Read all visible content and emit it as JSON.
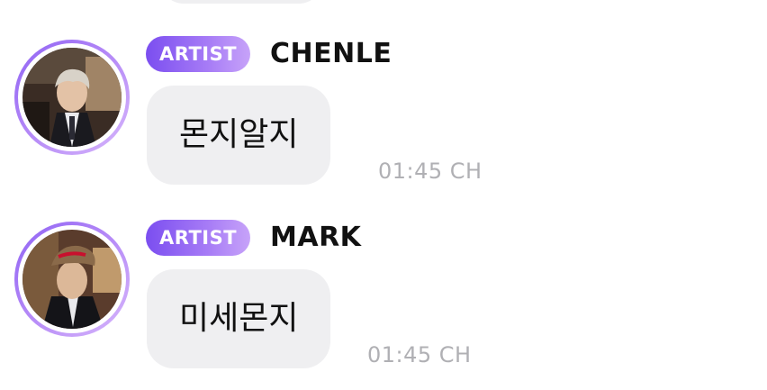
{
  "messages": [
    {
      "badge": "ARTIST",
      "author": "CHENLE",
      "text": "몬지알지",
      "time": "01:45 CH"
    },
    {
      "badge": "ARTIST",
      "author": "MARK",
      "text": "미세몬지",
      "time": "01:45 CH"
    }
  ]
}
